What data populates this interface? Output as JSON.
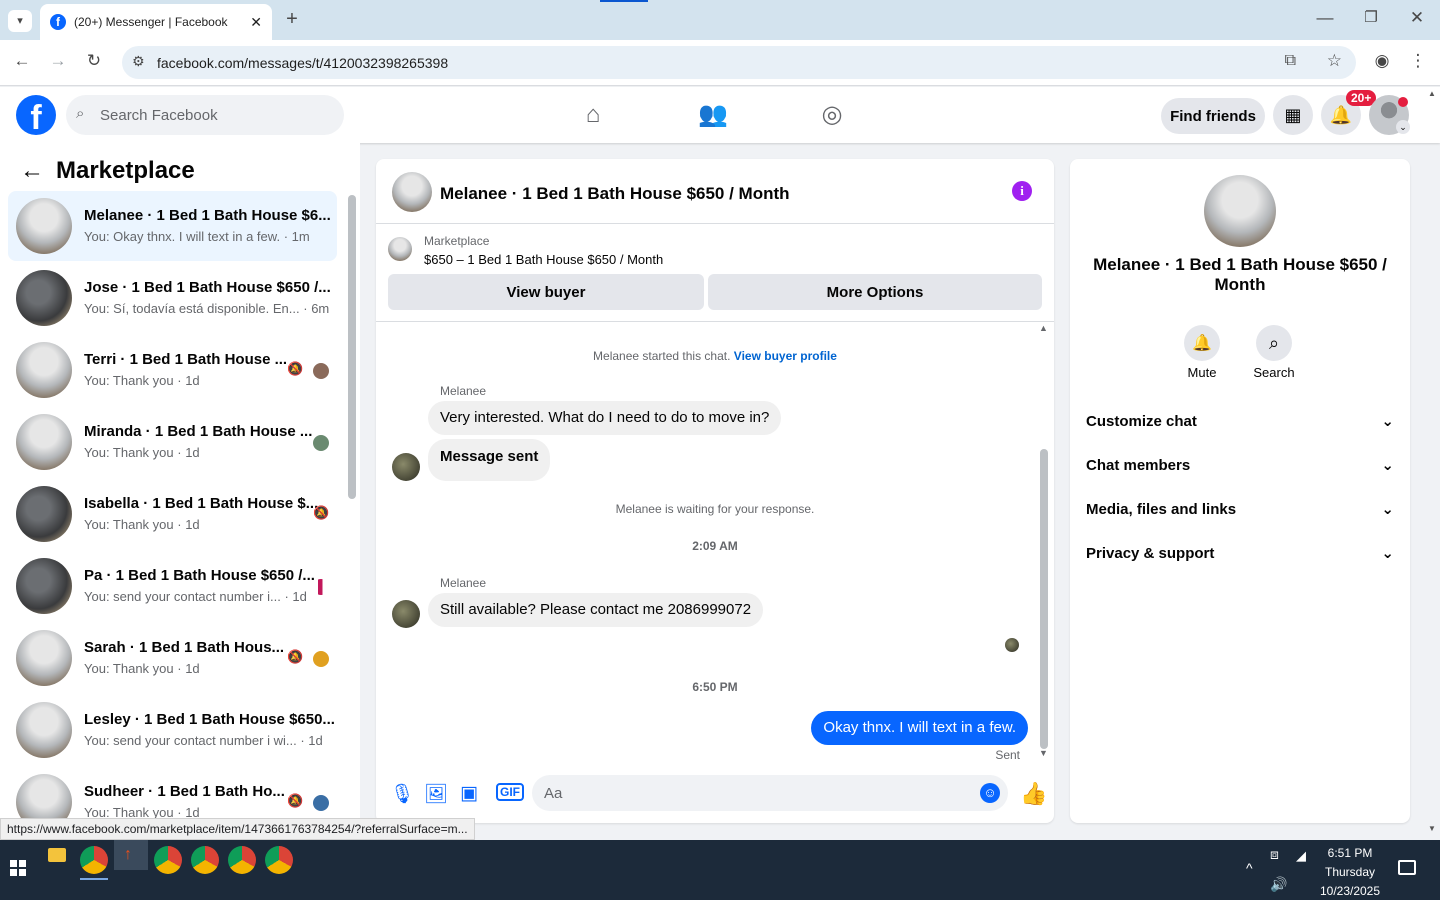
{
  "browser": {
    "tab_title": "(20+) Messenger | Facebook",
    "url": "facebook.com/messages/t/4120032398265398",
    "status_url": "https://www.facebook.com/marketplace/item/1473661763784254/?referralSurface=m..."
  },
  "header": {
    "search_placeholder": "Search Facebook",
    "find_friends": "Find friends",
    "notif_badge": "20+"
  },
  "left": {
    "title": "Marketplace",
    "conversations": [
      {
        "name": "Melanee · 1 Bed 1 Bath House $6...",
        "preview": "You: Okay thnx. I will text in a few.",
        "time": "· 1m"
      },
      {
        "name": "Jose · 1 Bed 1 Bath House $650 /...",
        "preview": "You: Sí, todavía está disponible. En...",
        "time": "· 6m"
      },
      {
        "name": "Terri · 1 Bed 1 Bath House ...",
        "preview": "You: Thank you",
        "time": "· 1d"
      },
      {
        "name": "Miranda · 1 Bed 1 Bath House ...",
        "preview": "You: Thank you",
        "time": "· 1d"
      },
      {
        "name": "Isabella · 1 Bed 1 Bath House $...",
        "preview": "You: Thank you",
        "time": "· 1d"
      },
      {
        "name": "Pa · 1 Bed 1 Bath House $650 /...",
        "preview": "You: send your contact number i...",
        "time": "· 1d"
      },
      {
        "name": "Sarah · 1 Bed 1 Bath Hous...",
        "preview": "You: Thank you",
        "time": "· 1d"
      },
      {
        "name": "Lesley · 1 Bed 1 Bath House $650...",
        "preview": "You: send your contact number i wi...",
        "time": "· 1d"
      },
      {
        "name": "Sudheer · 1 Bed 1 Bath Ho...",
        "preview": "You: Thank you",
        "time": "· 1d"
      }
    ]
  },
  "chat": {
    "title": "Melanee · 1 Bed 1 Bath House $650 / Month",
    "listing_label": "Marketplace",
    "listing_text": "$650 – 1 Bed 1 Bath House $650 / Month",
    "view_buyer": "View buyer",
    "more_options": "More Options",
    "started_text": "Melanee started this chat.",
    "view_buyer_profile": "View buyer profile",
    "sender1": "Melanee",
    "msg1": "Very interested. What do I need to do to move in?",
    "msg2": "Message sent",
    "waiting": "Melanee is waiting for your response.",
    "time1": "2:09 AM",
    "sender2": "Melanee",
    "msg3": "Still available? Please contact me 2086999072",
    "time2": "6:50 PM",
    "msg_out": "Okay thnx. I will text in a few.",
    "sent_label": "Sent",
    "compose_placeholder": "Aa"
  },
  "right": {
    "title": "Melanee · 1 Bed 1 Bath House $650 / Month",
    "mute": "Mute",
    "search": "Search",
    "rows": [
      "Customize chat",
      "Chat members",
      "Media, files and links",
      "Privacy & support"
    ]
  },
  "taskbar": {
    "time": "6:51 PM",
    "day": "Thursday",
    "date": "10/23/2025"
  }
}
